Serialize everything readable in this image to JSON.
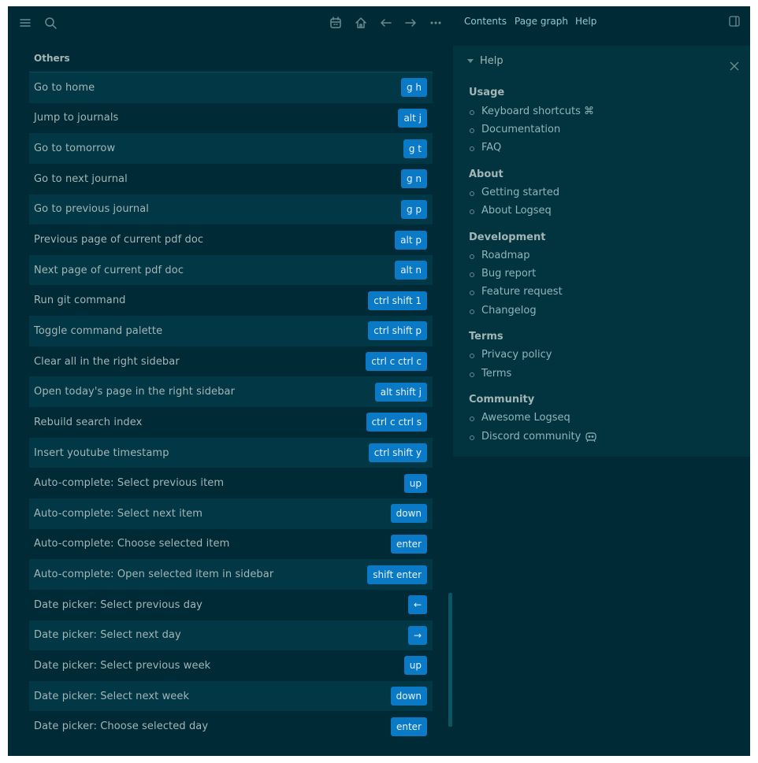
{
  "topbar": {
    "icons": [
      "menu-icon",
      "search-icon",
      "calendar-icon",
      "home-icon",
      "arrow-left-icon",
      "arrow-right-icon",
      "more-icon"
    ]
  },
  "shortcuts": {
    "section_title": "Others",
    "rows": [
      {
        "label": "Go to home",
        "key": "g h"
      },
      {
        "label": "Jump to journals",
        "key": "alt j"
      },
      {
        "label": "Go to tomorrow",
        "key": "g t"
      },
      {
        "label": "Go to next journal",
        "key": "g n"
      },
      {
        "label": "Go to previous journal",
        "key": "g p"
      },
      {
        "label": "Previous page of current pdf doc",
        "key": "alt p"
      },
      {
        "label": "Next page of current pdf doc",
        "key": "alt n"
      },
      {
        "label": "Run git command",
        "key": "ctrl shift 1"
      },
      {
        "label": "Toggle command palette",
        "key": "ctrl shift p"
      },
      {
        "label": "Clear all in the right sidebar",
        "key": "ctrl c ctrl c"
      },
      {
        "label": "Open today's page in the right sidebar",
        "key": "alt shift j"
      },
      {
        "label": "Rebuild search index",
        "key": "ctrl c ctrl s"
      },
      {
        "label": "Insert youtube timestamp",
        "key": "ctrl shift y"
      },
      {
        "label": "Auto-complete: Select previous item",
        "key": "up"
      },
      {
        "label": "Auto-complete: Select next item",
        "key": "down"
      },
      {
        "label": "Auto-complete: Choose selected item",
        "key": "enter"
      },
      {
        "label": "Auto-complete: Open selected item in sidebar",
        "key": "shift enter"
      },
      {
        "label": "Date picker: Select previous day",
        "key": "←"
      },
      {
        "label": "Date picker: Select next day",
        "key": "→"
      },
      {
        "label": "Date picker: Select previous week",
        "key": "up"
      },
      {
        "label": "Date picker: Select next week",
        "key": "down"
      },
      {
        "label": "Date picker: Choose selected day",
        "key": "enter"
      }
    ]
  },
  "right_sidebar": {
    "tabs": [
      "Contents",
      "Page graph",
      "Help"
    ],
    "help": {
      "title": "Help",
      "groups": [
        {
          "title": "Usage",
          "links": [
            "Keyboard shortcuts ⌘",
            "Documentation",
            "FAQ"
          ]
        },
        {
          "title": "About",
          "links": [
            "Getting started",
            "About Logseq"
          ]
        },
        {
          "title": "Development",
          "links": [
            "Roadmap",
            "Bug report",
            "Feature request",
            "Changelog"
          ]
        },
        {
          "title": "Terms",
          "links": [
            "Privacy policy",
            "Terms"
          ]
        },
        {
          "title": "Community",
          "links": [
            "Awesome Logseq",
            "Discord community"
          ]
        }
      ]
    }
  },
  "colors": {
    "background": "#002b36",
    "row_alt": "#023845",
    "kbd": "#0b7ac6",
    "text": "#a4b5b6",
    "link": "#93b3bb"
  }
}
